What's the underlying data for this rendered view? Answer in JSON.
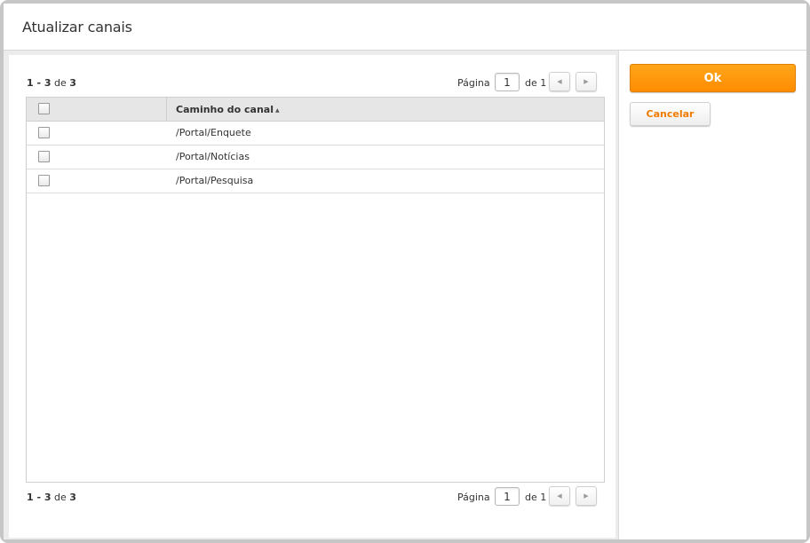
{
  "dialog": {
    "title": "Atualizar canais"
  },
  "pager_top": {
    "range_start": "1",
    "range_sep": " - ",
    "range_end": "3",
    "range_of": " de ",
    "range_total": "3",
    "page_label": "Página",
    "page_value": "1",
    "page_of": "de 1",
    "prev_icon": "chevron-left-icon",
    "next_icon": "chevron-right-icon"
  },
  "pager_bottom": {
    "range_start": "1",
    "range_sep": " - ",
    "range_end": "3",
    "range_of": " de ",
    "range_total": "3",
    "page_label": "Página",
    "page_value": "1",
    "page_of": "de 1",
    "prev_icon": "chevron-left-icon",
    "next_icon": "chevron-right-icon"
  },
  "grid": {
    "column_header": "Caminho do canal",
    "sort_direction": "ascending",
    "rows": [
      {
        "path": "/Portal/Enquete",
        "checked": false
      },
      {
        "path": "/Portal/Notícias",
        "checked": false
      },
      {
        "path": "/Portal/Pesquisa",
        "checked": false
      }
    ]
  },
  "actions": {
    "ok_label": "Ok",
    "cancel_label": "Cancelar"
  },
  "colors": {
    "accent": "#ff8c00",
    "cancel_text": "#f07b00",
    "header_bg": "#e6e6e6"
  }
}
